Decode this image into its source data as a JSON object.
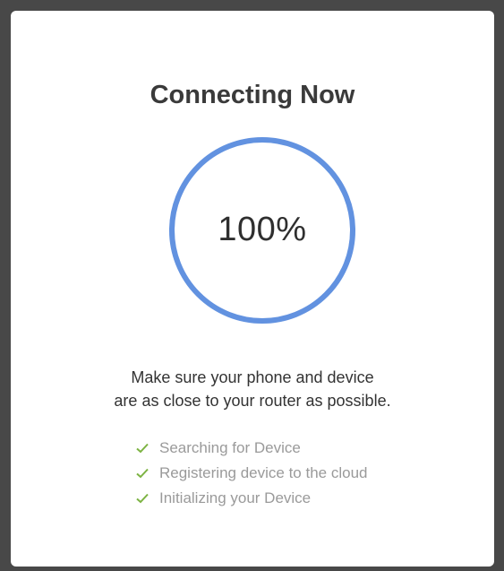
{
  "title": "Connecting Now",
  "progress": {
    "percent_label": "100%",
    "value": 1.0,
    "ring_color": "#6292e0"
  },
  "message": {
    "line1": "Make sure your phone and device",
    "line2": "are as close to your router as possible."
  },
  "check_color": "#7cb342",
  "steps": [
    {
      "label": "Searching for Device",
      "icon": "check-icon",
      "done": true
    },
    {
      "label": "Registering device to the cloud",
      "icon": "check-icon",
      "done": true
    },
    {
      "label": "Initializing your Device",
      "icon": "check-icon",
      "done": true
    }
  ]
}
